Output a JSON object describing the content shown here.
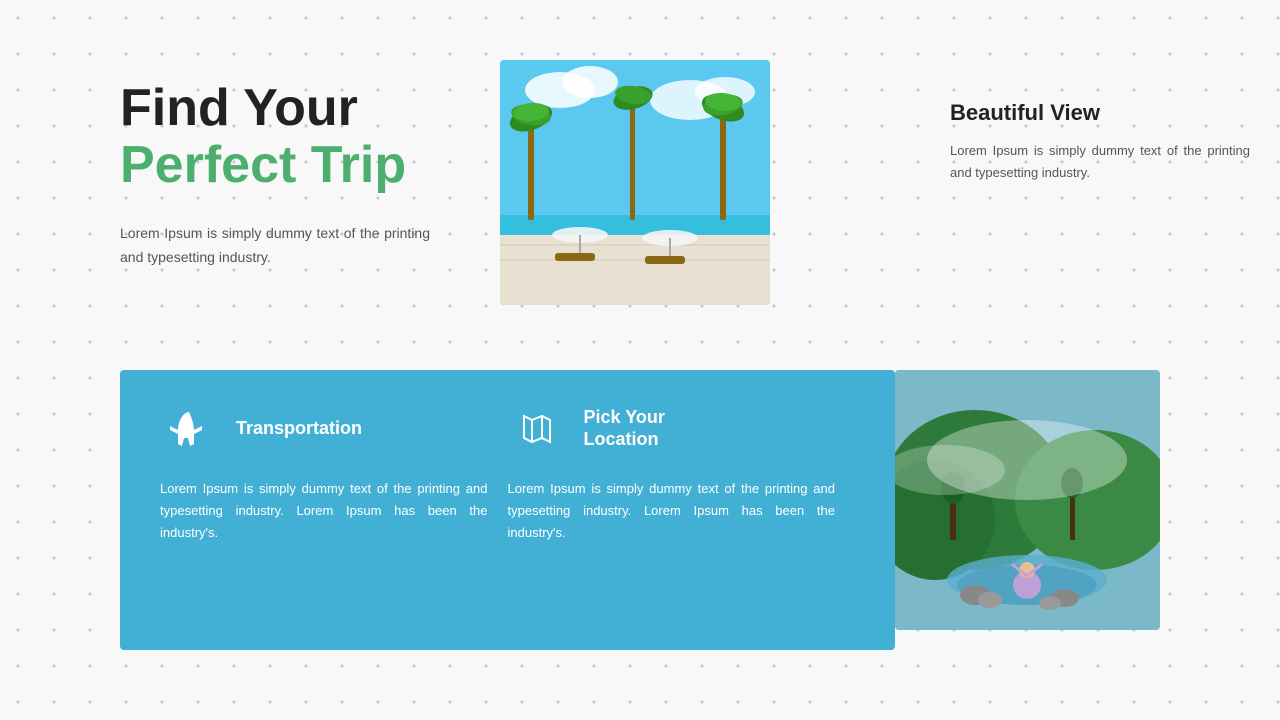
{
  "hero": {
    "title_line1": "Find Your",
    "title_line2": "Perfect Trip",
    "description": "Lorem Ipsum is simply dummy text of the printing and typesetting industry."
  },
  "beautiful_view": {
    "title": "Beautiful View",
    "text": "Lorem Ipsum is simply dummy text of the printing and typesetting industry."
  },
  "transportation": {
    "label": "Transportation",
    "description": "Lorem Ipsum is simply dummy text of the printing and typesetting industry. Lorem Ipsum has been the industry's."
  },
  "pick_location": {
    "label_line1": "Pick Your",
    "label_line2": "Location",
    "description": "Lorem Ipsum is simply dummy text of the printing and typesetting industry. Lorem Ipsum has been the industry's."
  }
}
